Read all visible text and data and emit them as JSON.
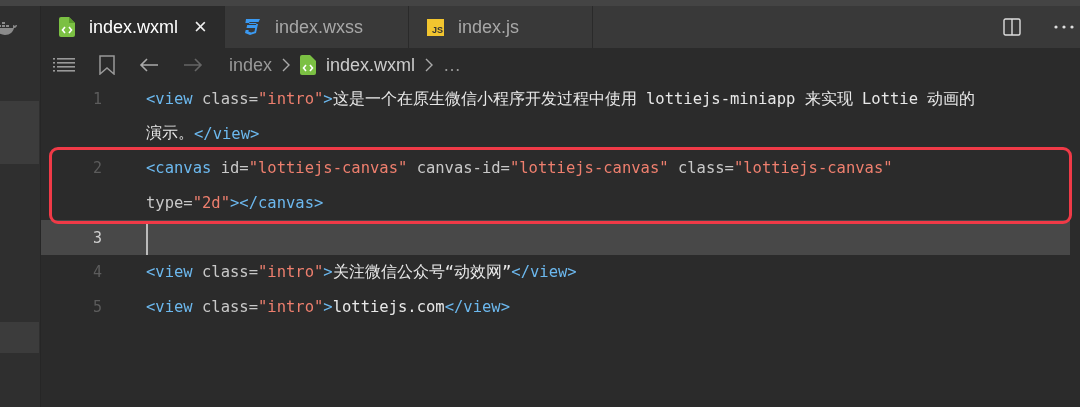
{
  "tabs": [
    {
      "label": "index.wxml",
      "kind": "wxml",
      "selected": true,
      "close": "×"
    },
    {
      "label": "index.wxss",
      "kind": "css",
      "selected": false
    },
    {
      "label": "index.js",
      "kind": "js",
      "selected": false,
      "badge": "JS"
    }
  ],
  "breadcrumb": {
    "folder": "index",
    "file": "index.wxml",
    "more": "…"
  },
  "lines": [
    {
      "number": "1",
      "current": false,
      "rows": [
        [
          {
            "kind": "tag",
            "text": "<view"
          },
          {
            "kind": "attr",
            "text": " class="
          },
          {
            "kind": "str",
            "text": "\"intro\""
          },
          {
            "kind": "tag",
            "text": ">"
          },
          {
            "kind": "text",
            "text": "这是一个在原生微信小程序开发过程中使用 lottiejs-miniapp 来实现 Lottie 动画的"
          }
        ],
        [
          {
            "kind": "text",
            "text": "演示。"
          },
          {
            "kind": "tag",
            "text": "</view>"
          }
        ]
      ]
    },
    {
      "number": "2",
      "current": false,
      "rows": [
        [
          {
            "kind": "tag",
            "text": "<canvas"
          },
          {
            "kind": "attr",
            "text": " id="
          },
          {
            "kind": "str",
            "text": "\"lottiejs-canvas\""
          },
          {
            "kind": "attr",
            "text": " canvas-id="
          },
          {
            "kind": "str",
            "text": "\"lottiejs-canvas\""
          },
          {
            "kind": "attr",
            "text": " class="
          },
          {
            "kind": "str",
            "text": "\"lottiejs-canvas\""
          }
        ],
        [
          {
            "kind": "attr",
            "text": "type="
          },
          {
            "kind": "str",
            "text": "\"2d\""
          },
          {
            "kind": "tag",
            "text": "></canvas>"
          }
        ]
      ]
    },
    {
      "number": "3",
      "current": true,
      "rows": [
        []
      ]
    },
    {
      "number": "4",
      "current": false,
      "rows": [
        [
          {
            "kind": "tag",
            "text": "<view"
          },
          {
            "kind": "attr",
            "text": " class="
          },
          {
            "kind": "str",
            "text": "\"intro\""
          },
          {
            "kind": "tag",
            "text": ">"
          },
          {
            "kind": "text",
            "text": "关注微信公众号“动效网”"
          },
          {
            "kind": "tag",
            "text": "</view>"
          }
        ]
      ]
    },
    {
      "number": "5",
      "current": false,
      "rows": [
        [
          {
            "kind": "tag",
            "text": "<view"
          },
          {
            "kind": "attr",
            "text": " class="
          },
          {
            "kind": "str",
            "text": "\"intro\""
          },
          {
            "kind": "tag",
            "text": ">"
          },
          {
            "kind": "text",
            "text": "lottiejs.com"
          },
          {
            "kind": "tag",
            "text": "</view>"
          }
        ]
      ]
    }
  ]
}
